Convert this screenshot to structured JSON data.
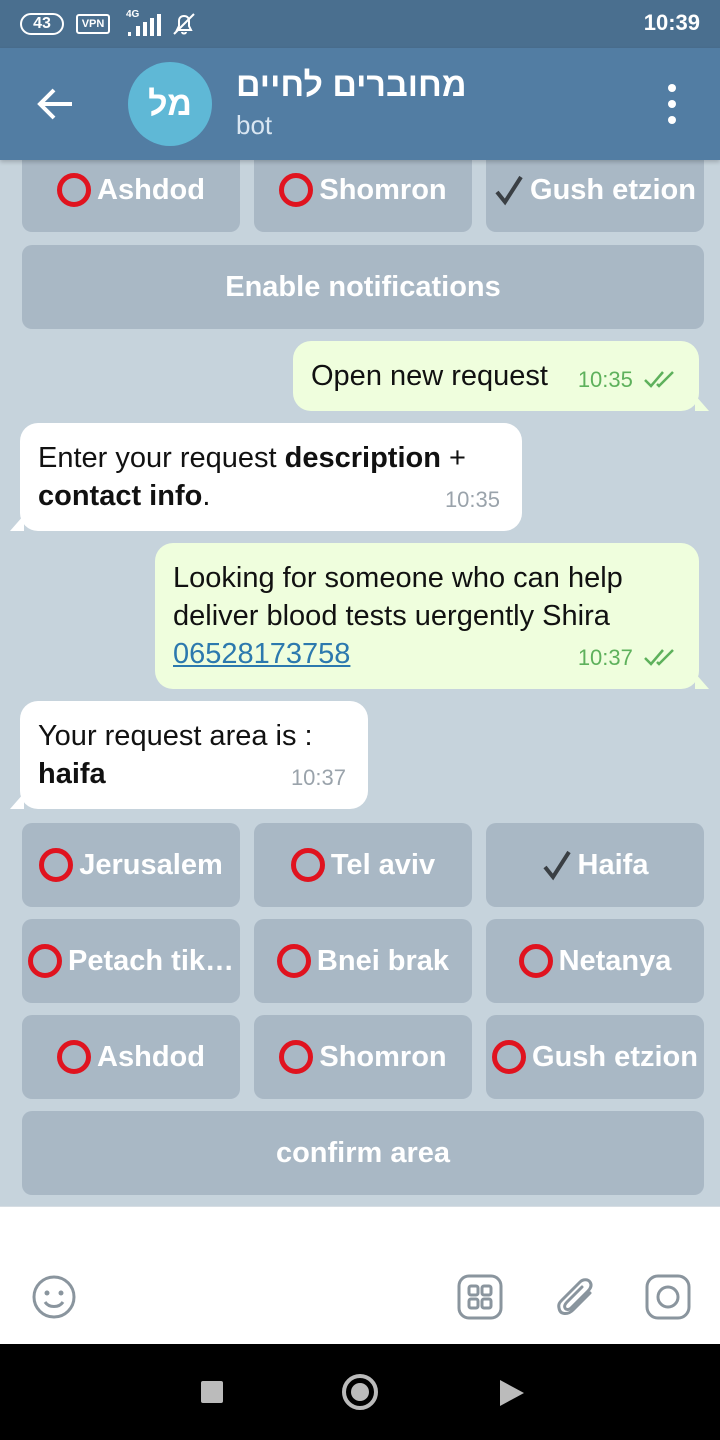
{
  "status_bar": {
    "battery": "43",
    "vpn": "VPN",
    "network": "4G",
    "time": "10:39"
  },
  "header": {
    "avatar_text": "מל",
    "title": "מחוברים לחיים",
    "subtitle": "bot"
  },
  "keyboard_top": {
    "row1": [
      {
        "label": "Ashdod",
        "state": "unselected"
      },
      {
        "label": "Shomron",
        "state": "unselected"
      },
      {
        "label": "Gush etzion",
        "state": "selected"
      }
    ],
    "enable_notifications": "Enable notifications"
  },
  "messages": [
    {
      "type": "out",
      "text": "Open new request",
      "time": "10:35"
    },
    {
      "type": "in",
      "text_plain": "Enter your request ",
      "text_bold": "description",
      "text_plain2": " + ",
      "text_bold2": "contact info",
      "text_plain3": ".",
      "time": "10:35"
    },
    {
      "type": "out",
      "text": "Looking for someone who can help deliver blood tests uergently Shira",
      "phone": "06528173758",
      "time": "10:37"
    },
    {
      "type": "in",
      "text_plain": "Your request area is : ",
      "text_bold": "haifa",
      "time": "10:37"
    }
  ],
  "keyboard_area": {
    "rows": [
      [
        {
          "label": "Jerusalem",
          "state": "unselected"
        },
        {
          "label": "Tel aviv",
          "state": "unselected"
        },
        {
          "label": "Haifa",
          "state": "selected"
        }
      ],
      [
        {
          "label": "Petach tik…",
          "state": "unselected"
        },
        {
          "label": "Bnei brak",
          "state": "unselected"
        },
        {
          "label": "Netanya",
          "state": "unselected"
        }
      ],
      [
        {
          "label": "Ashdod",
          "state": "unselected"
        },
        {
          "label": "Shomron",
          "state": "unselected"
        },
        {
          "label": "Gush etzion",
          "state": "unselected"
        }
      ]
    ],
    "confirm": "confirm area"
  },
  "colors": {
    "header": "#527da3",
    "status_bar": "#4a6f8f",
    "outgoing_bubble": "#effedd",
    "keyboard_button": "#a9b8c5",
    "ring": "#e0131f"
  },
  "icons": {
    "emoji": "emoji-icon",
    "bot_keyboard": "bot-keyboard-icon",
    "attach": "paperclip-icon",
    "camera": "camera-icon"
  }
}
